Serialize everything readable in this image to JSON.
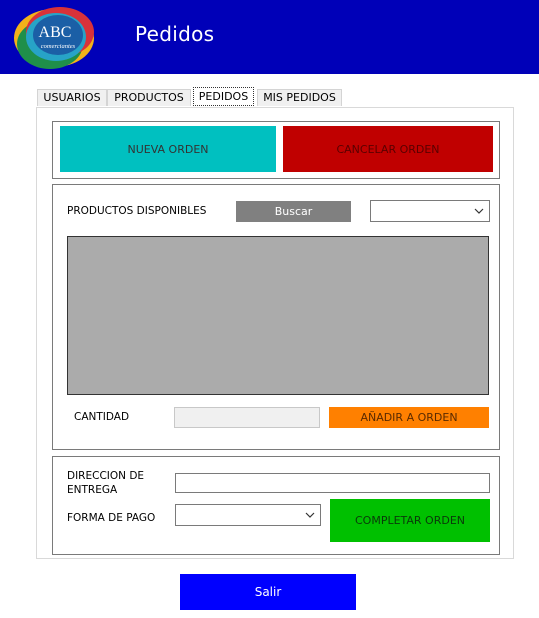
{
  "header": {
    "title": "Pedidos",
    "logo_text": "ABC",
    "logo_subtitle": "comerciantes"
  },
  "tabs": [
    {
      "label": "USUARIOS"
    },
    {
      "label": "PRODUCTOS"
    },
    {
      "label": "PEDIDOS",
      "active": true
    },
    {
      "label": "MIS PEDIDOS"
    }
  ],
  "order_actions": {
    "new_order": "NUEVA ORDEN",
    "cancel_order": "CANCELAR ORDEN"
  },
  "products": {
    "label": "PRODUCTOS DISPONIBLES",
    "search_button": "Buscar",
    "filter_value": "",
    "quantity_label": "CANTIDAD",
    "quantity_value": "",
    "add_button": "AÑADIR A ORDEN"
  },
  "checkout": {
    "address_label_line1": "DIRECCION DE",
    "address_label_line2": "ENTREGA",
    "address_value": "",
    "payment_label": "FORMA DE PAGO",
    "payment_value": "",
    "complete_button": "COMPLETAR ORDEN"
  },
  "footer": {
    "exit_button": "Salir"
  },
  "colors": {
    "header": "#0000b8",
    "new_order": "#00c0c0",
    "cancel_order": "#c00000",
    "search": "#808080",
    "grid": "#ababab",
    "add": "#ff8000",
    "complete": "#00c000",
    "exit": "#0000ff"
  }
}
